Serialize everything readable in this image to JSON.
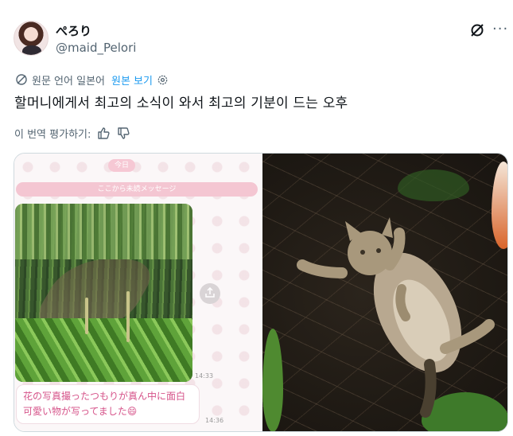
{
  "author": {
    "display_name": "ぺろり",
    "handle": "@maid_Pelori"
  },
  "translation": {
    "source_note": "원문 언어 일본어",
    "show_original": "원본 보기"
  },
  "tweet": {
    "text": "할머니에게서 최고의 소식이 와서 최고의 기분이 드는 오후"
  },
  "rate_translation": {
    "label": "이 번역 평가하기:"
  },
  "chat_screenshot": {
    "date_label": "今日",
    "unread_divider": "ここから未読メッセージ",
    "photo_time": "14:33",
    "message_text": "花の写真撮ったつもりが真ん中に面白可愛い物が写ってました😄",
    "message_time": "14:36"
  },
  "icons": {
    "translate": "translate-icon",
    "settings": "gear-icon",
    "grok": "grok-icon",
    "more": "more-icon",
    "thumbs_up": "thumbs-up-icon",
    "thumbs_down": "thumbs-down-icon",
    "share": "share-icon"
  },
  "colors": {
    "link": "#1d9bf0",
    "secondary_text": "#536471",
    "chat_pink": "#d6548a"
  }
}
